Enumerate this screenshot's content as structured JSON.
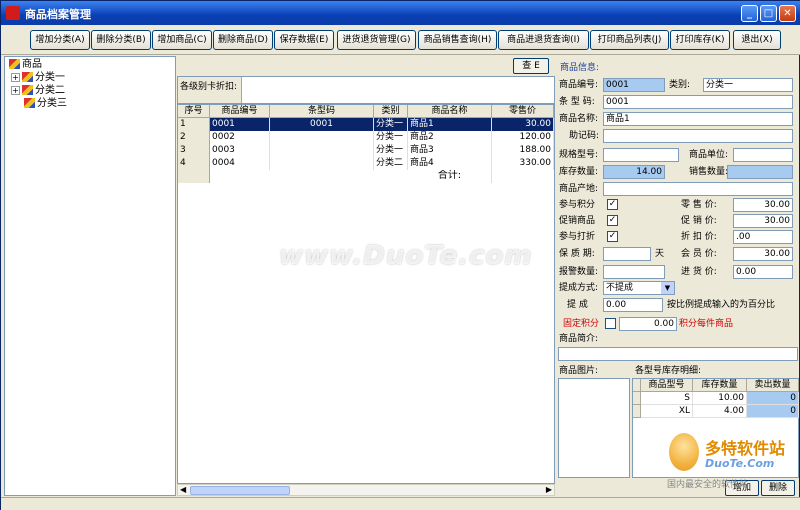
{
  "window": {
    "title": "商品档案管理"
  },
  "toolbar": {
    "buttons": [
      "增加分类(A)",
      "删除分类(B)",
      "增加商品(C)",
      "删除商品(D)",
      "保存数据(E)",
      "进货退货管理(G)",
      "商品销售查询(H)",
      "商品进退货查询(I)",
      "打印商品列表(J)",
      "打印库存(K)",
      "退出(X)"
    ]
  },
  "tree": {
    "root": "商品",
    "children": [
      "分类一",
      "分类二",
      "分类三"
    ]
  },
  "middle": {
    "query_button": "查 E",
    "filter_label": "各级别卡折扣:",
    "columns": [
      "序号",
      "商品编号",
      "条型码",
      "类别",
      "商品名称",
      "零售价"
    ],
    "rows": [
      {
        "idx": "1",
        "code": "0001",
        "barcode": "0001",
        "cat": "分类一",
        "name": "商品1",
        "price": "30.00"
      },
      {
        "idx": "2",
        "code": "0002",
        "barcode": "",
        "cat": "分类一",
        "name": "商品2",
        "price": "120.00"
      },
      {
        "idx": "3",
        "code": "0003",
        "barcode": "",
        "cat": "分类一",
        "name": "商品3",
        "price": "188.00"
      },
      {
        "idx": "4",
        "code": "0004",
        "barcode": "",
        "cat": "分类二",
        "name": "商品4",
        "price": "330.00"
      }
    ],
    "total_label": "合计:"
  },
  "detail": {
    "section_title": "商品信息:",
    "code_label": "商品编号:",
    "code": "0001",
    "category_label": "类别:",
    "category": "分类一",
    "barcode_label": "条 型 码:",
    "barcode": "0001",
    "name_label": "商品名称:",
    "name": "商品1",
    "mnemonic_label": "助记码:",
    "mnemonic": "",
    "spec_label": "规格型号:",
    "spec": "",
    "unit_label": "商品单位:",
    "unit": "",
    "stock_label": "库存数量:",
    "stock": "14.00",
    "sold_label": "销售数量:",
    "sold": "",
    "origin_label": "商品产地:",
    "origin": "",
    "points_label": "参与积分",
    "points_checked": "✓",
    "retail_label": "零 售 价:",
    "retail": "30.00",
    "promo_label": "促销商品",
    "promo_checked": "✓",
    "promo_price_label": "促 销 价:",
    "promo_price": "30.00",
    "discount_label": "参与打折",
    "discount_checked": "✓",
    "discount_price_label": "折 扣 价:",
    "discount_price": ".00",
    "warranty_label": "保 质 期:",
    "warranty": "",
    "warranty_unit": "天",
    "member_label": "会 员 价:",
    "member_price": "30.00",
    "alarm_label": "报警数量:",
    "alarm": "",
    "purchase_label": "进 货 价:",
    "purchase_price": "0.00",
    "commission_mode_label": "提成方式:",
    "commission_mode": "不提成",
    "commission_label": "提  成",
    "commission": "0.00",
    "commission_note": "按比例提成输入的为百分比",
    "fixed_points_label": "固定积分",
    "fixed_points": "0.00",
    "fixed_points_note": "积分每件商品",
    "intro_label": "商品简介:",
    "picture_label": "商品图片:",
    "stock_detail_label": "各型号库存明细:",
    "stock_columns": [
      "商品型号",
      "库存数量",
      "卖出数量"
    ],
    "stock_rows": [
      {
        "model": "S",
        "qty": "10.00",
        "sold": "0"
      },
      {
        "model": "XL",
        "qty": "4.00",
        "sold": "0"
      }
    ],
    "add_button": "增加",
    "delete_button": "删除"
  },
  "watermark": {
    "text": "www.DuoTe.com"
  },
  "corner_logo": {
    "name": "多特软件站",
    "brand": "DuoTe.Com",
    "slogan": "国内最安全的软件站"
  }
}
